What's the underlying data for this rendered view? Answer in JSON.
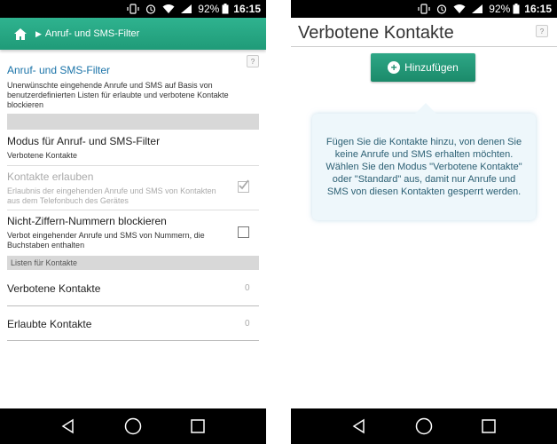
{
  "status_bar": {
    "battery": "92%",
    "time": "16:15"
  },
  "left": {
    "appbar": {
      "title": "Anruf- und SMS-Filter"
    },
    "help_label": "?",
    "section": {
      "title": "Anruf- und SMS-Filter",
      "description": "Unerwünschte eingehende Anrufe und SMS auf Basis von benutzerdefinierten Listen für erlaubte und verbotene Kontakte blockieren"
    },
    "mode": {
      "title": "Modus für Anruf- und SMS-Filter",
      "value": "Verbotene Kontakte"
    },
    "allow_contacts": {
      "title": "Kontakte erlauben",
      "description": "Erlaubnis der eingehenden Anrufe und SMS von Kontakten aus dem Telefonbuch des Gerätes",
      "checked": true
    },
    "block_non_digit": {
      "title": "Nicht-Ziffern-Nummern blockieren",
      "description": "Verbot eingehender Anrufe und SMS von Nummern, die Buchstaben enthalten",
      "checked": false
    },
    "lists_header": "Listen für Kontakte",
    "lists": [
      {
        "label": "Verbotene Kontakte",
        "count": "0"
      },
      {
        "label": "Erlaubte Kontakte",
        "count": "0"
      }
    ]
  },
  "right": {
    "title": "Verbotene Kontakte",
    "help_label": "?",
    "add_button_label": "Hinzufügen",
    "info_text": "Fügen Sie die Kontakte hinzu, von denen Sie keine Anrufe und SMS erhalten möchten. Wählen Sie den Modus \"Verbotene Kontakte\" oder \"Standard\" aus, damit nur Anrufe und SMS von diesen Kontakten gesperrt werden."
  },
  "colors": {
    "accent": "#1f9b78",
    "link_blue": "#1a73a8"
  }
}
